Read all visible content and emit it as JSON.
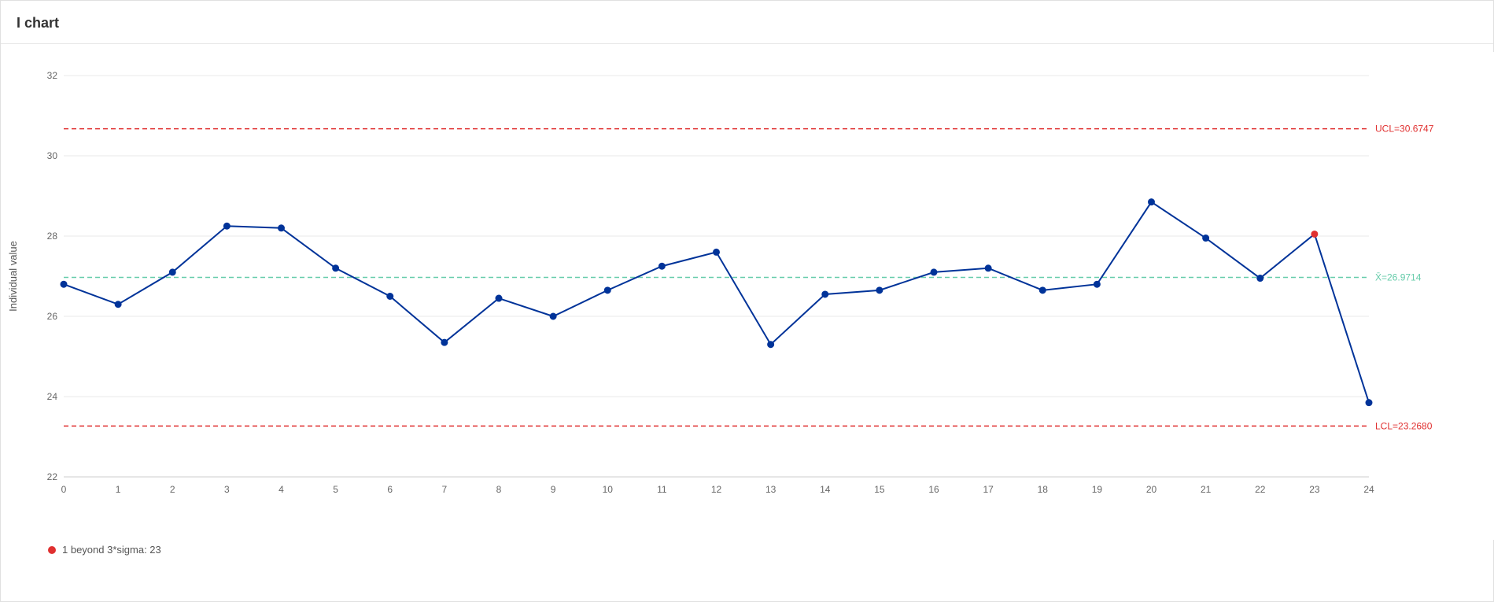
{
  "title": "I chart",
  "download_icon": "↓",
  "ucl": {
    "value": 30.6747,
    "label": "UCL=30.6747",
    "y": 30.6747
  },
  "mean": {
    "value": 26.9714,
    "label": "X̄=26.9714",
    "y": 26.9714
  },
  "lcl": {
    "value": 23.268,
    "label": "LCL=23.2680",
    "y": 23.268
  },
  "y_axis": {
    "label": "Individual value",
    "min": 22,
    "max": 32
  },
  "x_axis": {
    "min": 0,
    "max": 24
  },
  "data_points": [
    {
      "x": 0,
      "y": 26.8,
      "out_of_control": false
    },
    {
      "x": 1,
      "y": 26.3,
      "out_of_control": false
    },
    {
      "x": 2,
      "y": 27.1,
      "out_of_control": false
    },
    {
      "x": 3,
      "y": 28.25,
      "out_of_control": false
    },
    {
      "x": 4,
      "y": 28.2,
      "out_of_control": false
    },
    {
      "x": 5,
      "y": 27.2,
      "out_of_control": false
    },
    {
      "x": 6,
      "y": 26.5,
      "out_of_control": false
    },
    {
      "x": 7,
      "y": 25.35,
      "out_of_control": false
    },
    {
      "x": 8,
      "y": 26.45,
      "out_of_control": false
    },
    {
      "x": 9,
      "y": 26.0,
      "out_of_control": false
    },
    {
      "x": 10,
      "y": 26.65,
      "out_of_control": false
    },
    {
      "x": 11,
      "y": 27.25,
      "out_of_control": false
    },
    {
      "x": 12,
      "y": 27.6,
      "out_of_control": false
    },
    {
      "x": 13,
      "y": 25.3,
      "out_of_control": false
    },
    {
      "x": 14,
      "y": 26.55,
      "out_of_control": false
    },
    {
      "x": 15,
      "y": 26.65,
      "out_of_control": false
    },
    {
      "x": 16,
      "y": 27.1,
      "out_of_control": false
    },
    {
      "x": 17,
      "y": 27.2,
      "out_of_control": false
    },
    {
      "x": 18,
      "y": 26.65,
      "out_of_control": false
    },
    {
      "x": 19,
      "y": 26.8,
      "out_of_control": false
    },
    {
      "x": 20,
      "y": 28.85,
      "out_of_control": false
    },
    {
      "x": 21,
      "y": 27.95,
      "out_of_control": false
    },
    {
      "x": 22,
      "y": 26.95,
      "out_of_control": false
    },
    {
      "x": 23,
      "y": 28.05,
      "out_of_control": true
    },
    {
      "x": 24,
      "y": 23.85,
      "out_of_control": false
    }
  ],
  "legend": {
    "text": "1 beyond 3*sigma: 23"
  },
  "colors": {
    "line": "#003399",
    "point": "#003399",
    "point_oc": "#e03030",
    "ucl_line": "#e03030",
    "lcl_line": "#e03030",
    "mean_line": "#66ccaa"
  }
}
